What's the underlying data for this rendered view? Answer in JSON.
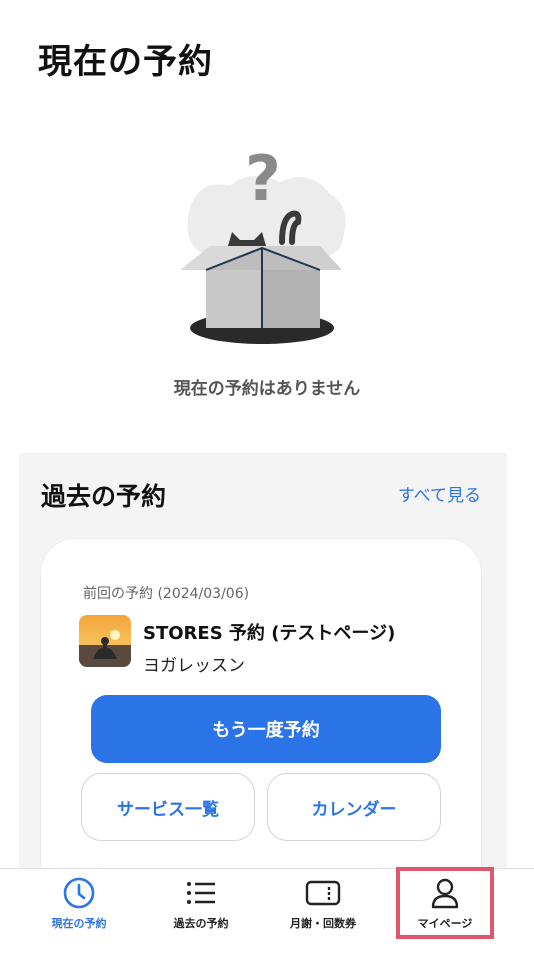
{
  "header": {
    "title": "現在の予約"
  },
  "empty_state": {
    "message": "現在の予約はありません"
  },
  "past": {
    "title": "過去の予約",
    "see_all": "すべて見る",
    "card": {
      "previous_label": "前回の予約 (2024/03/06)",
      "store_name": "STORES 予約 (テストページ)",
      "service_name": "ヨガレッスン",
      "rebook_label": "もう一度予約",
      "services_label": "サービス一覧",
      "calendar_label": "カレンダー"
    }
  },
  "tabs": [
    {
      "label": "現在の予約",
      "icon": "clock-icon",
      "active": true
    },
    {
      "label": "過去の予約",
      "icon": "list-icon",
      "active": false
    },
    {
      "label": "月謝・回数券",
      "icon": "ticket-icon",
      "active": false
    },
    {
      "label": "マイページ",
      "icon": "person-icon",
      "active": false
    }
  ],
  "colors": {
    "accent": "#2b74e8",
    "highlight": "#e0566a",
    "section_bg": "#f4f4f5"
  }
}
